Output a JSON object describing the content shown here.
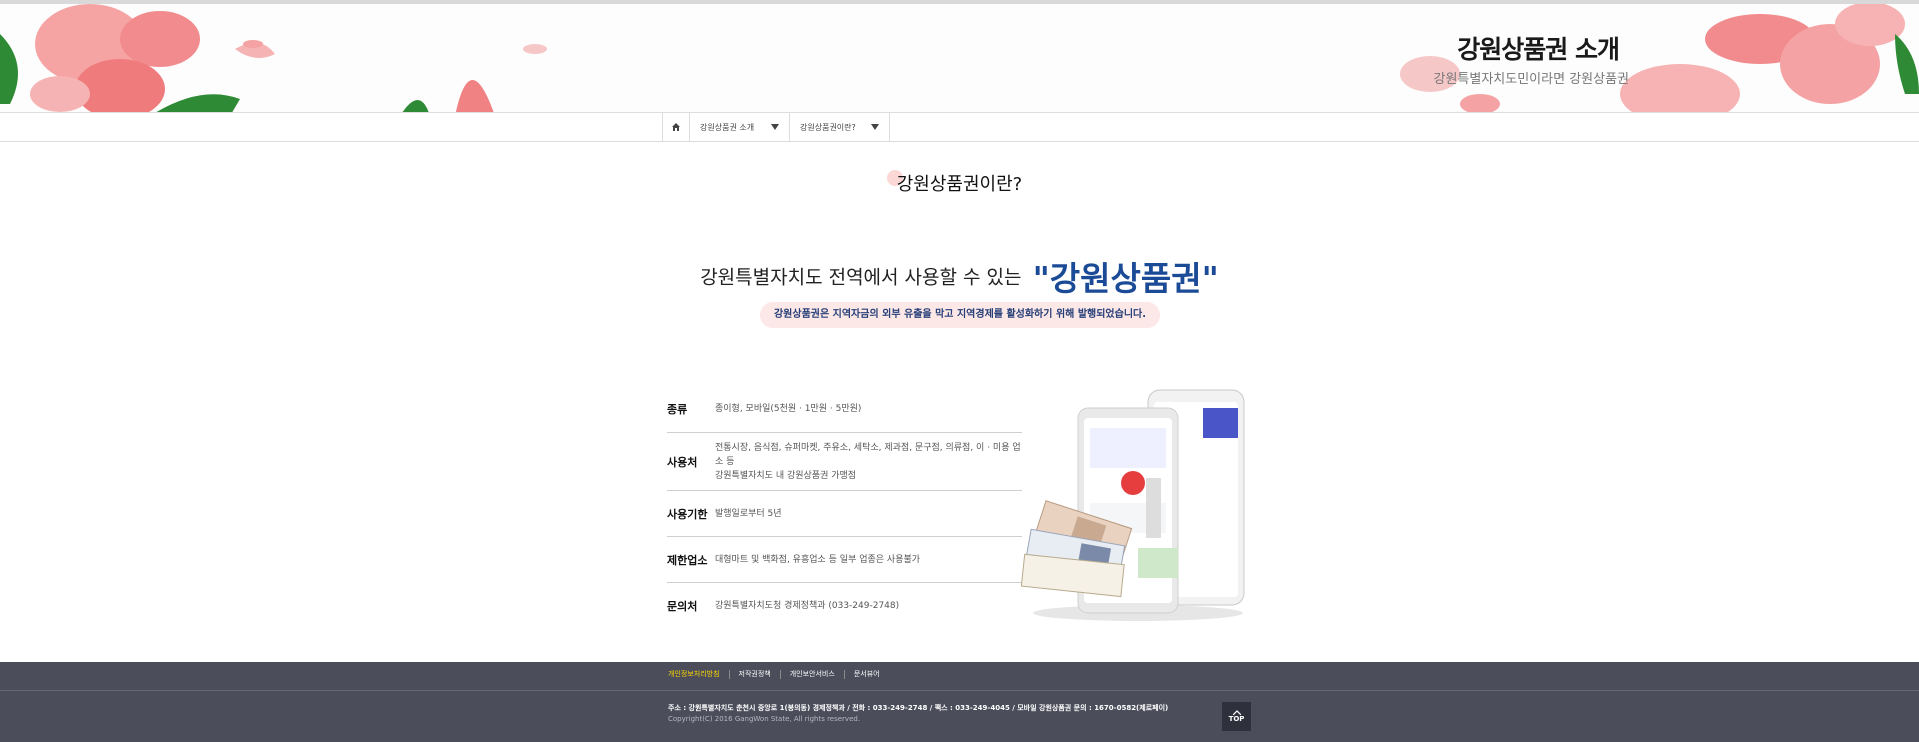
{
  "banner": {
    "title": "강원상품권 소개",
    "subtitle": "강원특별자치도민이라면 강원상품권"
  },
  "nav": {
    "home_icon": "home-icon",
    "crumbs": [
      {
        "label": "강원상품권 소개"
      },
      {
        "label": "강원상품권이란?"
      }
    ]
  },
  "main": {
    "page_title": "강원상품권이란?",
    "headline_pre": "강원특별자치도 전역에서 사용할 수 있는",
    "headline_big": "\"강원상품권\"",
    "pill_text": "강원상품권은 지역자금의 외부 유출을 막고 지역경제를 활성화하기 위해 발행되었습니다."
  },
  "info": [
    {
      "key": "종류",
      "value": "종이형, 모바일(5천원 · 1만원 · 5만원)"
    },
    {
      "key": "사용처",
      "value": "전통시장, 음식점, 슈퍼마켓, 주유소, 세탁소, 제과점, 문구점, 의류점, 이 · 미용 업소 등",
      "value2": "강원특별자치도 내 강원상품권 가맹점"
    },
    {
      "key": "사용기한",
      "value": "발행일로부터 5년"
    },
    {
      "key": "제한업소",
      "value": "대형마트 및 백화점, 유흥업소 등 일부 업종은 사용불가"
    },
    {
      "key": "문의처",
      "value": "강원특별자치도청 경제정책과 (033-249-2748)"
    }
  ],
  "footer": {
    "links": [
      "개인정보처리방침",
      "저작권정책",
      "개인보안서비스",
      "문서뷰어"
    ],
    "address": "주소 : 강원특별자치도 춘천시 중앙로 1(봉의동) 경제정책과 / 전화 : 033-249-2748 / 팩스 : 033-249-4045 / 모바일 강원상품권 문의 : 1670-0582(제로페이)",
    "copyright": "Copyright(C) 2016 GangWon State, All rights reserved.",
    "top_label": "TOP"
  },
  "colors": {
    "accent": "#1b4a97",
    "pill_bg": "#fce8e6",
    "footer_bg": "#4b4d5b",
    "footer_highlight": "#ffd800",
    "flower_pink": "#f28b8d",
    "leaf_green": "#2f8a35"
  }
}
